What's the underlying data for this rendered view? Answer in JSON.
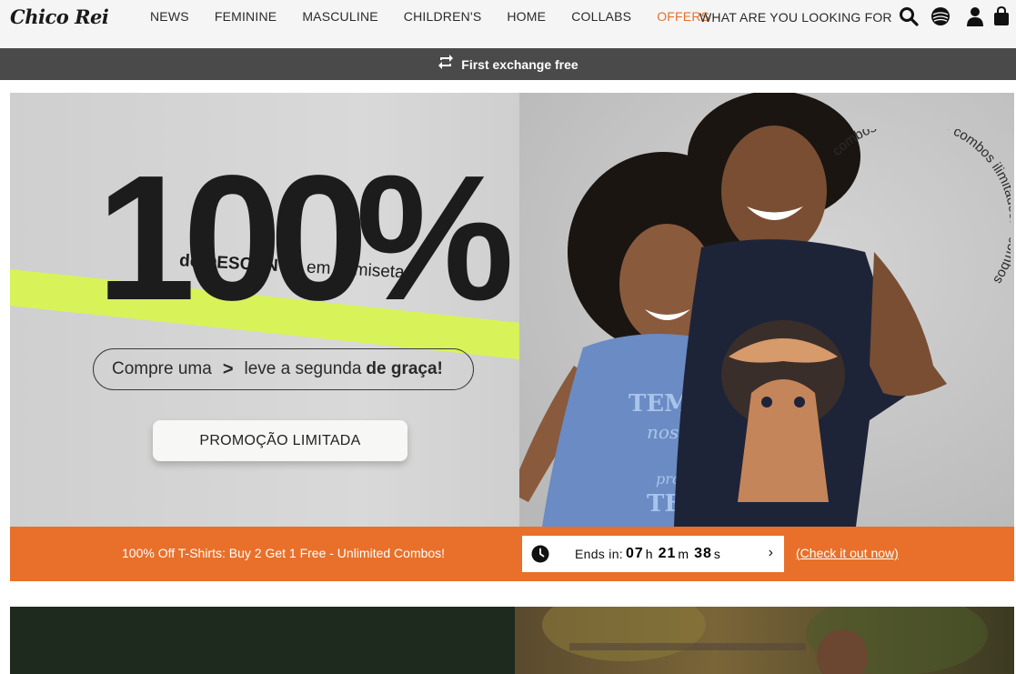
{
  "header": {
    "logo": "Chico Rei",
    "nav": [
      "NEWS",
      "FEMININE",
      "MASCULINE",
      "CHILDREN'S",
      "HOME",
      "COLLABS",
      "OFFERS"
    ],
    "search_label": "WHAT ARE YOU LOOKING FOR",
    "icons": [
      "search-icon",
      "globe-icon",
      "user-icon",
      "bag-icon"
    ]
  },
  "promo_bar": {
    "text": "First exchange free",
    "icon": "exchange-icon"
  },
  "banner": {
    "headline": "100%",
    "subheadline_bold": "de DESCONTO",
    "subheadline_rest": " em camisetas",
    "pill_text": "Compre uma",
    "pill_arrow": ">",
    "pill_text2": "leve a segunda",
    "pill_bold": "de graça!",
    "button": "PROMOÇÃO LIMITADA",
    "curved_text": "combos ilimitados! • combos ilimitados! • combos",
    "shirt_text_1": "TEMO",
    "shirt_text_2": "nosso",
    "shirt_text_3": "próprio",
    "shirt_text_4": "TEMPO"
  },
  "countdown_bar": {
    "message": "100% Off T-Shirts: Buy 2 Get 1 Free - Unlimited Combos!",
    "ends_label": "Ends in:",
    "hours": "07",
    "hours_unit": "h",
    "minutes": "21",
    "minutes_unit": "m",
    "seconds": "38",
    "seconds_unit": "s",
    "chevron": "›",
    "link": "(Check it out now)"
  },
  "colors": {
    "accent_orange": "#e8702a",
    "promo_bar_bg": "#4a4a4a",
    "stripe_lime": "#d8f25a"
  }
}
